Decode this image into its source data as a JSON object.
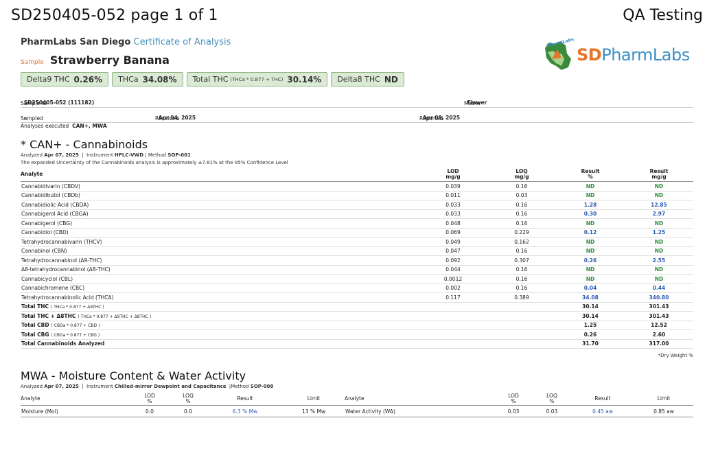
{
  "header": {
    "title": "SD250405-052 page 1 of 1",
    "qa": "QA Testing"
  },
  "lab": {
    "name": "PharmLabs San Diego",
    "doc": "Certificate of Analysis"
  },
  "sample": {
    "tag": "Sample",
    "name": "Strawberry Banana"
  },
  "pills": [
    {
      "label": "Delta9 THC",
      "formula": "",
      "value": "0.26%"
    },
    {
      "label": "THCa",
      "formula": "",
      "value": "34.08%"
    },
    {
      "label": "Total THC",
      "formula": "(THCa * 0.877 + THC)",
      "value": "30.14%"
    },
    {
      "label": "Delta8 THC",
      "formula": "",
      "value": "ND"
    }
  ],
  "logo": {
    "sd": "SD",
    "pharm": "PharmLabs",
    "mark": "PharmLabs"
  },
  "meta": {
    "sample_id_label": "Sample ID",
    "sample_id": "SD250405-052 (111182)",
    "matrix_label": "Matrix",
    "matrix": "Flower",
    "sampled_label": "Sampled",
    "sampled": "-",
    "received_label": "Received",
    "received": "Apr 04, 2025",
    "reported_label": "Reported",
    "reported": "Apr 08, 2025",
    "analyses_label": "Analyses executed",
    "analyses": "CAN+, MWA"
  },
  "can": {
    "title": "* CAN+ - Cannabinoids",
    "analyzed_label": "Analyzed",
    "analyzed": "Apr 07, 2025",
    "instrument_label": "Instrument",
    "instrument": "HPLC-VWD",
    "method_label": "Method",
    "method": "SOP-001",
    "note": "The expanded Uncertainty of the Cannabinoids analysis is approximately ±7.81% at the 95% Confidence Level",
    "headers": {
      "analyte": "Analyte",
      "lod": "LOD",
      "lod_unit": "mg/g",
      "loq": "LOQ",
      "loq_unit": "mg/g",
      "res_pct": "Result",
      "res_pct_unit": "%",
      "res_mg": "Result",
      "res_mg_unit": "mg/g"
    },
    "rows": [
      {
        "name": "Cannabidivarin (CBDV)",
        "lod": "0.039",
        "loq": "0.16",
        "pct": "ND",
        "mg": "ND"
      },
      {
        "name": "Cannabidibutol (CBDb)",
        "lod": "0.011",
        "loq": "0.03",
        "pct": "ND",
        "mg": "ND"
      },
      {
        "name": "Cannabidiolic Acid (CBDA)",
        "lod": "0.033",
        "loq": "0.16",
        "pct": "1.28",
        "mg": "12.85"
      },
      {
        "name": "Cannabigerol Acid (CBGA)",
        "lod": "0.033",
        "loq": "0.16",
        "pct": "0.30",
        "mg": "2.97"
      },
      {
        "name": "Cannabigerol (CBG)",
        "lod": "0.048",
        "loq": "0.16",
        "pct": "ND",
        "mg": "ND"
      },
      {
        "name": "Cannabidiol (CBD)",
        "lod": "0.069",
        "loq": "0.229",
        "pct": "0.12",
        "mg": "1.25"
      },
      {
        "name": "Tetrahydrocannabivarin (THCV)",
        "lod": "0.049",
        "loq": "0.162",
        "pct": "ND",
        "mg": "ND"
      },
      {
        "name": "Cannabinol (CBN)",
        "lod": "0.047",
        "loq": "0.16",
        "pct": "ND",
        "mg": "ND"
      },
      {
        "name": "Tetrahydrocannabinol (Δ9-THC)",
        "lod": "0.092",
        "loq": "0.307",
        "pct": "0.26",
        "mg": "2.55"
      },
      {
        "name": "Δ8-tetrahydrocannabinol (Δ8-THC)",
        "lod": "0.044",
        "loq": "0.16",
        "pct": "ND",
        "mg": "ND"
      },
      {
        "name": "Cannabicyclol (CBL)",
        "lod": "0.0012",
        "loq": "0.16",
        "pct": "ND",
        "mg": "ND"
      },
      {
        "name": "Cannabichromene (CBC)",
        "lod": "0.002",
        "loq": "0.16",
        "pct": "0.04",
        "mg": "0.44"
      },
      {
        "name": "Tetrahydrocannabinolic Acid (THCA)",
        "lod": "0.117",
        "loq": "0.389",
        "pct": "34.08",
        "mg": "340.80"
      }
    ],
    "totals": [
      {
        "name": "Total THC",
        "formula": "( THCa * 0.877 + Δ9THC )",
        "pct": "30.14",
        "mg": "301.43"
      },
      {
        "name": "Total THC + Δ8THC",
        "formula": "( THCa * 0.877 + Δ9THC + Δ8THC )",
        "pct": "30.14",
        "mg": "301.43"
      },
      {
        "name": "Total CBD",
        "formula": "( CBDa * 0.877 + CBD )",
        "pct": "1.25",
        "mg": "12.52"
      },
      {
        "name": "Total CBG",
        "formula": "( CBGa * 0.877 + CBG )",
        "pct": "0.26",
        "mg": "2.60"
      },
      {
        "name": "Total Cannabinoids Analyzed",
        "formula": "",
        "pct": "31.70",
        "mg": "317.00"
      }
    ],
    "footnote": "*Dry Weight %"
  },
  "mwa": {
    "title": "MWA - Moisture Content & Water Activity",
    "analyzed_label": "Analyzed",
    "analyzed": "Apr 07, 2025",
    "instrument_label": "Instrument",
    "instrument": "Chilled-mirror Dewpoint and Capacitance",
    "method_label": "Method",
    "method": "SOP-008",
    "headers": {
      "analyte": "Analyte",
      "lod": "LOD",
      "lod_unit": "%",
      "loq": "LOQ",
      "loq_unit": "%",
      "result": "Result",
      "limit": "Limit"
    },
    "row": {
      "a1": "Moisture (Moi)",
      "lod1": "0.0",
      "loq1": "0.0",
      "res1": "6.3 % Mw",
      "lim1": "13 % Mw",
      "a2": "Water Activity (WA)",
      "lod2": "0.03",
      "loq2": "0.03",
      "res2": "0.45 aw",
      "lim2": "0.85 aw"
    }
  }
}
